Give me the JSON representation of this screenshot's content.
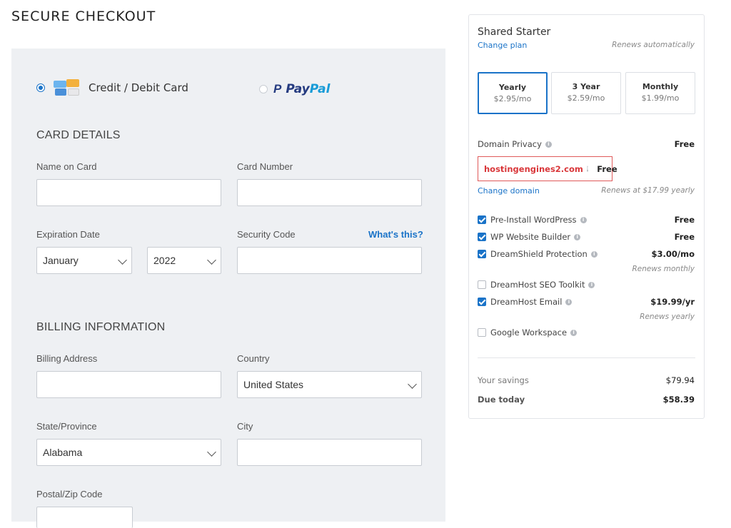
{
  "page": {
    "title": "SECURE CHECKOUT"
  },
  "payment": {
    "card_label": "Credit / Debit Card",
    "paypal_part1": "Pay",
    "paypal_part2": "Pal"
  },
  "card_details": {
    "heading": "CARD DETAILS",
    "name_label": "Name on Card",
    "name_value": "",
    "number_label": "Card Number",
    "number_value": "",
    "expiration_label": "Expiration Date",
    "month_value": "January",
    "year_value": "2022",
    "security_label": "Security Code",
    "security_value": "",
    "whats_this": "What's this?"
  },
  "billing": {
    "heading": "BILLING INFORMATION",
    "address_label": "Billing Address",
    "address_value": "",
    "country_label": "Country",
    "country_value": "United States",
    "state_label": "State/Province",
    "state_value": "Alabama",
    "city_label": "City",
    "city_value": "",
    "zip_label": "Postal/Zip Code",
    "zip_value": ""
  },
  "summary": {
    "plan_name": "Shared Starter",
    "change_plan": "Change plan",
    "renews_auto": "Renews automatically",
    "terms": [
      {
        "title": "Yearly",
        "price": "$2.95/mo",
        "active": true
      },
      {
        "title": "3 Year",
        "price": "$2.59/mo",
        "active": false
      },
      {
        "title": "Monthly",
        "price": "$1.99/mo",
        "active": false
      }
    ],
    "domain_privacy_label": "Domain Privacy",
    "domain_privacy_value": "Free",
    "domain_name": "hostingengines2.com",
    "domain_value": "Free",
    "change_domain": "Change domain",
    "renews_domain": "Renews at $17.99 yearly",
    "addons": {
      "wordpress_label": "Pre-Install WordPress",
      "wordpress_value": "Free",
      "builder_label": "WP Website Builder",
      "builder_value": "Free",
      "dreamshield_label": "DreamShield Protection",
      "dreamshield_value": "$3.00/mo",
      "dreamshield_renew": "Renews monthly",
      "seo_label": "DreamHost SEO Toolkit",
      "email_label": "DreamHost Email",
      "email_value": "$19.99/yr",
      "email_renew": "Renews yearly",
      "workspace_label": "Google Workspace"
    },
    "savings_label": "Your savings",
    "savings_value": "$79.94",
    "due_label": "Due today",
    "due_value": "$58.39"
  },
  "colors": {
    "accent": "#1a73c8",
    "domain_red": "#d9373a",
    "panel_bg": "#eef0f3"
  }
}
